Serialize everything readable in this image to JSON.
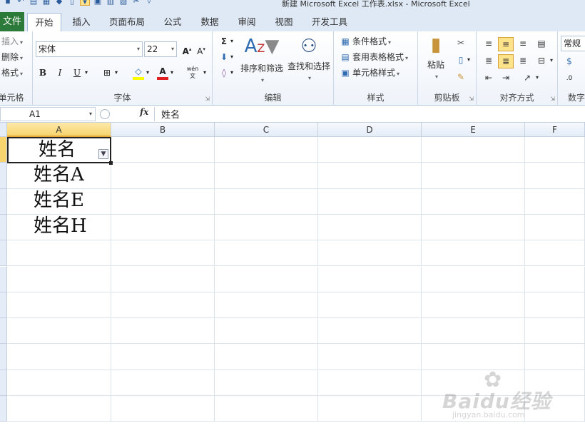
{
  "window": {
    "title": "新建 Microsoft Excel 工作表.xlsx - Microsoft Excel"
  },
  "tabs": [
    "文件",
    "开始",
    "插入",
    "页面布局",
    "公式",
    "数据",
    "审阅",
    "视图",
    "开发工具"
  ],
  "active_tab": "开始",
  "ribbon": {
    "cells_group": {
      "insert": "插入",
      "delete": "删除",
      "format": "格式",
      "name": "单元格"
    },
    "font_group": {
      "font_name": "宋体",
      "font_size": "22",
      "bold": "B",
      "italic": "I",
      "underline": "U",
      "name": "字体",
      "font_color": "#e02020",
      "fill_color": "#ffff00"
    },
    "editing_group": {
      "sort_filter": "排序和筛选",
      "find_select": "查找和选择",
      "name": "编辑"
    },
    "styles_group": {
      "conditional": "条件格式",
      "table_format": "套用表格格式",
      "cell_styles": "单元格样式",
      "name": "样式"
    },
    "clipboard_group": {
      "paste": "粘贴",
      "name": "剪贴板"
    },
    "alignment_group": {
      "name": "对齐方式"
    },
    "number_group": {
      "format": "常规",
      "name": "数字"
    }
  },
  "formula_bar": {
    "name_box": "A1",
    "fx": "fx",
    "content": "姓名"
  },
  "columns": [
    "A",
    "B",
    "C",
    "D",
    "E",
    "F"
  ],
  "cells": {
    "A1": "姓名",
    "A2": "姓名A",
    "A3": "姓名E",
    "A4": "姓名H"
  },
  "watermark": {
    "brand": "Baidu经验",
    "url": "jingyan.baidu.com"
  }
}
